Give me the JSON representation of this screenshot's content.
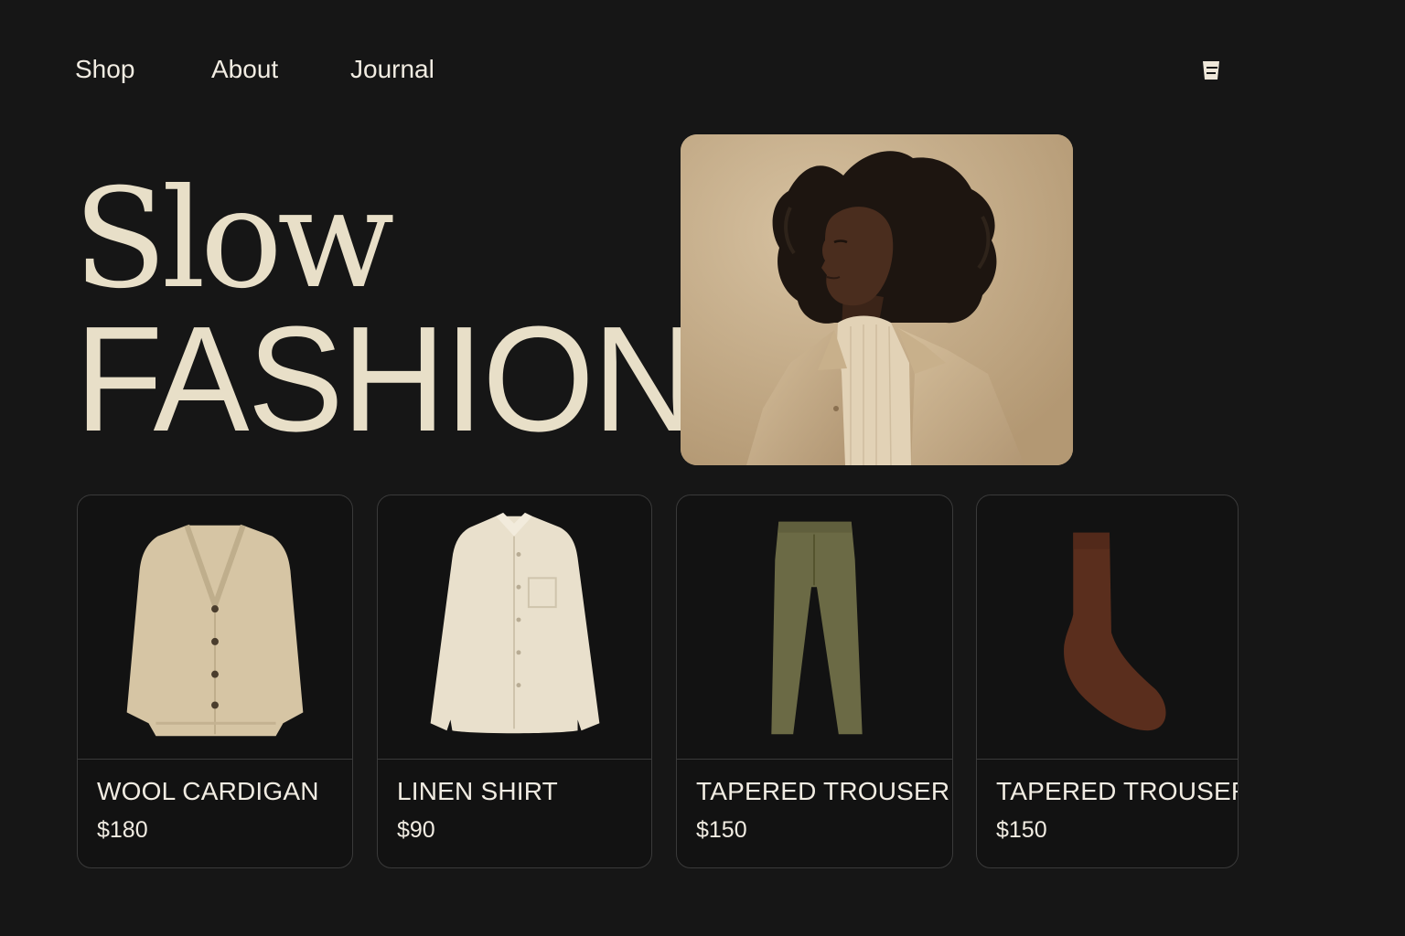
{
  "nav": {
    "items": [
      {
        "label": "Shop"
      },
      {
        "label": "About"
      },
      {
        "label": "Journal"
      }
    ],
    "cart_icon": "shopping-bag-icon"
  },
  "hero": {
    "line1": "Slow",
    "line2": "FASHION",
    "photo_subject": "model-portrait"
  },
  "products": [
    {
      "name": "WOOL CARDIGAN",
      "price": "$180",
      "image": "cardigan",
      "color": "#d6c5a4"
    },
    {
      "name": "LINEN SHIRT",
      "price": "$90",
      "image": "shirt",
      "color": "#e9e0cc"
    },
    {
      "name": "TAPERED TROUSER",
      "price": "$150",
      "image": "trouser",
      "color": "#6b6a45"
    },
    {
      "name": "TAPERED TROUSER",
      "price": "$150",
      "image": "sock",
      "color": "#5a2e1d"
    }
  ],
  "colors": {
    "background": "#161616",
    "headline": "#e8dfc8",
    "text": "#f1ece2",
    "card_border": "#3a3a3a"
  }
}
